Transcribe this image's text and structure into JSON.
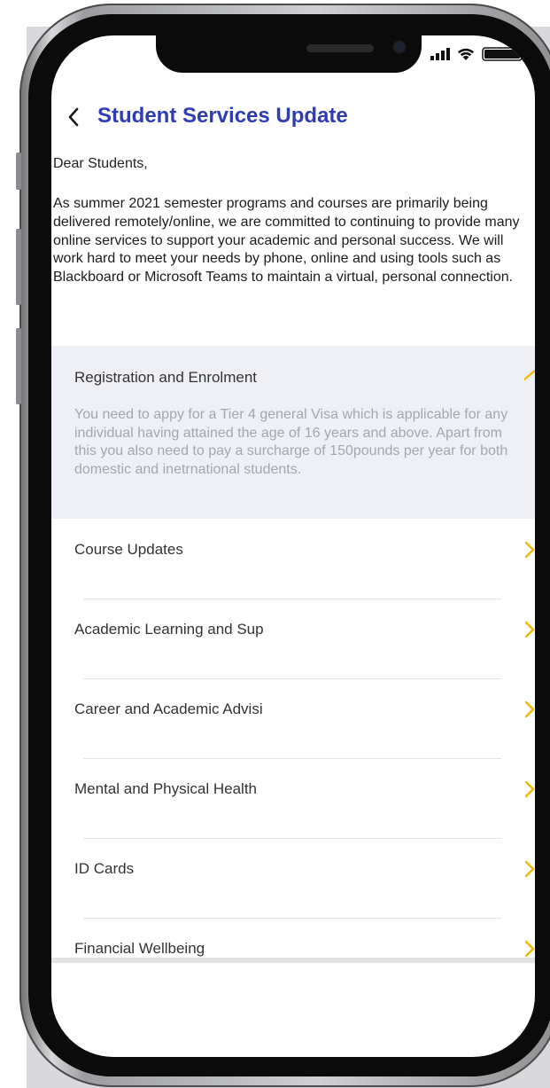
{
  "header": {
    "title": "Student Services Update"
  },
  "letter": {
    "greeting": "Dear Students,",
    "body": "As summer 2021 semester programs and courses are primarily being delivered remotely/online, we are committed to continuing to provide many online services to support your academic and personal success. We will work hard to meet your needs by phone, online and using tools such as Blackboard or Microsoft Teams to maintain a virtual, personal connection."
  },
  "accordion": {
    "open_item": {
      "title": "Registration and Enrolment",
      "body": "You need to appy for a Tier 4 general Visa which is applicable for any individual having attained the age of 16 years and above. Apart from this you also need to pay a surcharge of 150pounds per year for both domestic and inetrnational students."
    },
    "items": [
      {
        "label": "Course Updates"
      },
      {
        "label": "Academic Learning and Sup"
      },
      {
        "label": "Career and Academic Advisi"
      },
      {
        "label": "Mental and Physical Health"
      },
      {
        "label": "ID Cards"
      },
      {
        "label": "Financial Wellbeing"
      }
    ]
  },
  "icons": {
    "back": "back-chevron-icon",
    "expand": "chevron-icon",
    "signal": "cellular-signal-icon",
    "wifi": "wifi-icon",
    "battery": "battery-icon"
  },
  "colors": {
    "title": "#2e3cb5",
    "chevron_accent": "#f5b800",
    "open_panel_bg": "#eef0f6",
    "muted_text": "#a5a7ad"
  }
}
